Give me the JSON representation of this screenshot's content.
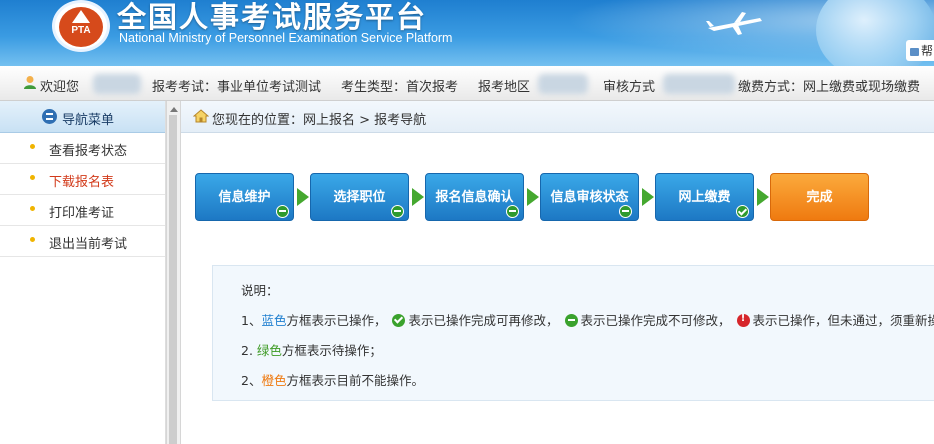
{
  "header": {
    "logo_text": "PTA",
    "title": "全国人事考试服务平台",
    "subtitle": "National Ministry of Personnel Examination Service Platform",
    "help_label": "帮"
  },
  "infobar": {
    "welcome": "欢迎您",
    "exam": "报考考试：事业单位考试测试",
    "candidate_type": "考生类型：首次报考",
    "region": "报考地区",
    "review_method": "审核方式",
    "payment": "缴费方式：网上缴费或现场缴费"
  },
  "sidebar": {
    "title": "导航菜单",
    "items": [
      {
        "label": "查看报考状态",
        "active": false
      },
      {
        "label": "下载报名表",
        "active": true
      },
      {
        "label": "打印准考证",
        "active": false
      },
      {
        "label": "退出当前考试",
        "active": false
      }
    ]
  },
  "breadcrumb": {
    "text": "您现在的位置：网上报名  >  报考导航"
  },
  "steps": [
    {
      "label": "信息维护",
      "color": "blue",
      "status": "minus"
    },
    {
      "label": "选择职位",
      "color": "blue",
      "status": "minus"
    },
    {
      "label": "报名信息确认",
      "color": "blue",
      "status": "minus"
    },
    {
      "label": "信息审核状态",
      "color": "blue",
      "status": "minus"
    },
    {
      "label": "网上缴费",
      "color": "blue",
      "status": "check"
    },
    {
      "label": "完成",
      "color": "orange",
      "status": "none"
    }
  ],
  "note": {
    "title": "说明：",
    "l1_prefix": "1、",
    "l1_color": "蓝色",
    "l1_a": "方框表示已操作，",
    "l1_b": "表示已操作完成可再修改，",
    "l1_c": "表示已操作完成不可修改，",
    "l1_d": "表示已操作，但未通过，须重新操作",
    "l2_prefix": "2. ",
    "l2_color": "绿色",
    "l2_rest": "方框表示待操作；",
    "l3_prefix": "2、",
    "l3_color": "橙色",
    "l3_rest": "方框表示目前不能操作。"
  },
  "colors": {
    "step_blue": "#1d78c4",
    "step_orange": "#ef7a10",
    "active_nav": "#d23a1a",
    "note_blue": "#1f7fd0",
    "note_green": "#3e9b25",
    "note_orange": "#ef7a10"
  }
}
